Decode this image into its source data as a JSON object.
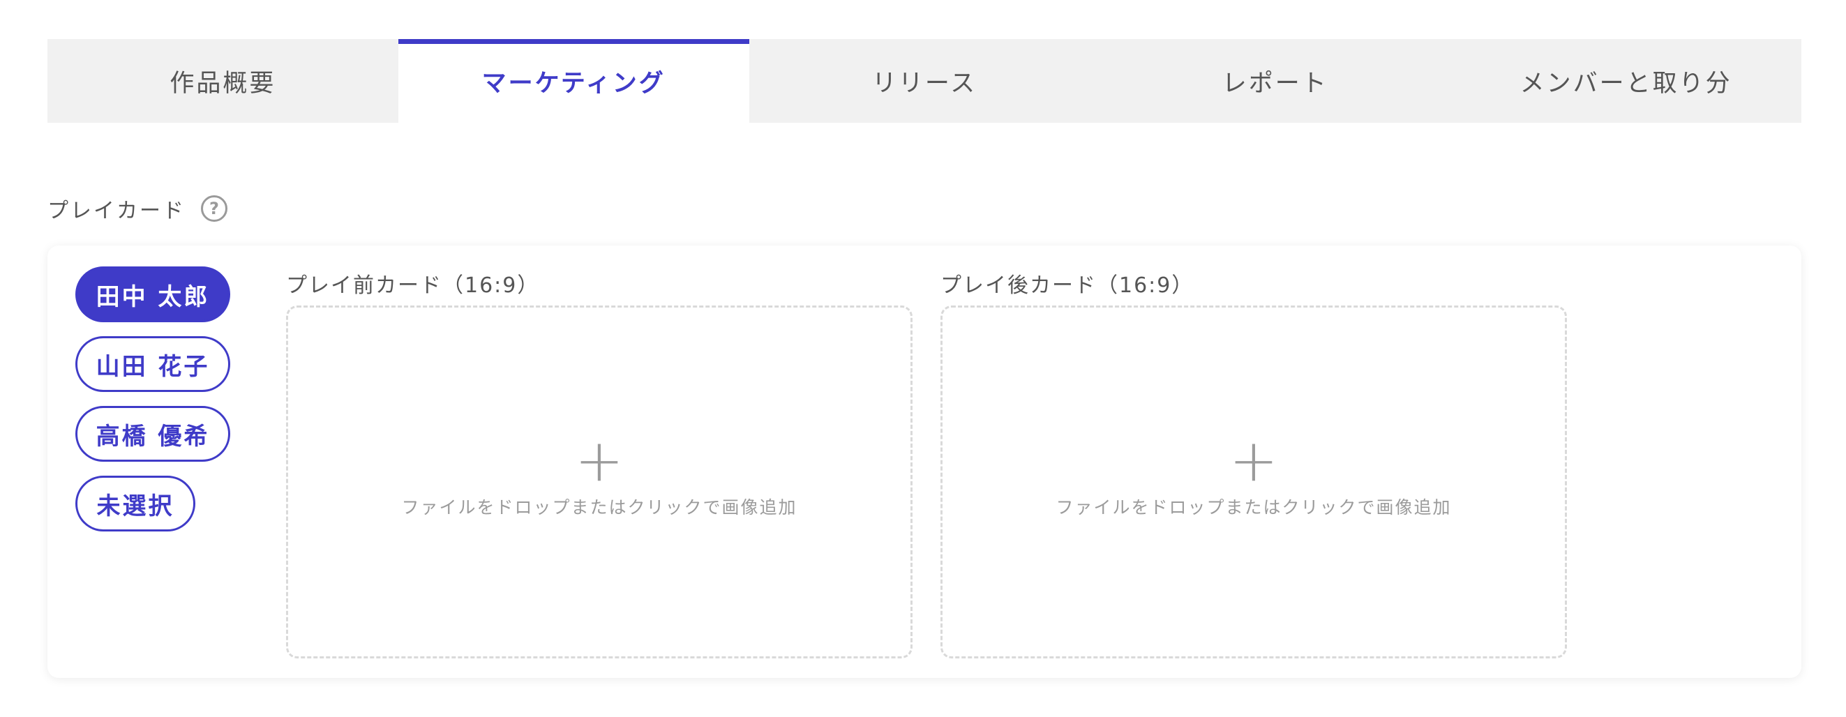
{
  "tabs": [
    {
      "label": "作品概要",
      "active": false
    },
    {
      "label": "マーケティング",
      "active": true
    },
    {
      "label": "リリース",
      "active": false
    },
    {
      "label": "レポート",
      "active": false
    },
    {
      "label": "メンバーと取り分",
      "active": false
    }
  ],
  "section": {
    "title": "プレイカード",
    "help_icon": "question-circle-icon",
    "help_glyph": "?"
  },
  "members": [
    {
      "name": "田中 太郎",
      "selected": true
    },
    {
      "name": "山田 花子",
      "selected": false
    },
    {
      "name": "高橋 優希",
      "selected": false
    },
    {
      "name": "未選択",
      "selected": false
    }
  ],
  "dropzones": [
    {
      "label": "プレイ前カード（16:9）",
      "plus": "+",
      "hint": "ファイルをドロップまたはクリックで画像追加"
    },
    {
      "label": "プレイ後カード（16:9）",
      "plus": "+",
      "hint": "ファイルをドロップまたはクリックで画像追加"
    }
  ],
  "colors": {
    "accent": "#3f3bc8",
    "tab_bar_bg": "#f1f1f1",
    "dashed_border": "#d9d9d9",
    "hint_text": "#9b9b9b"
  }
}
